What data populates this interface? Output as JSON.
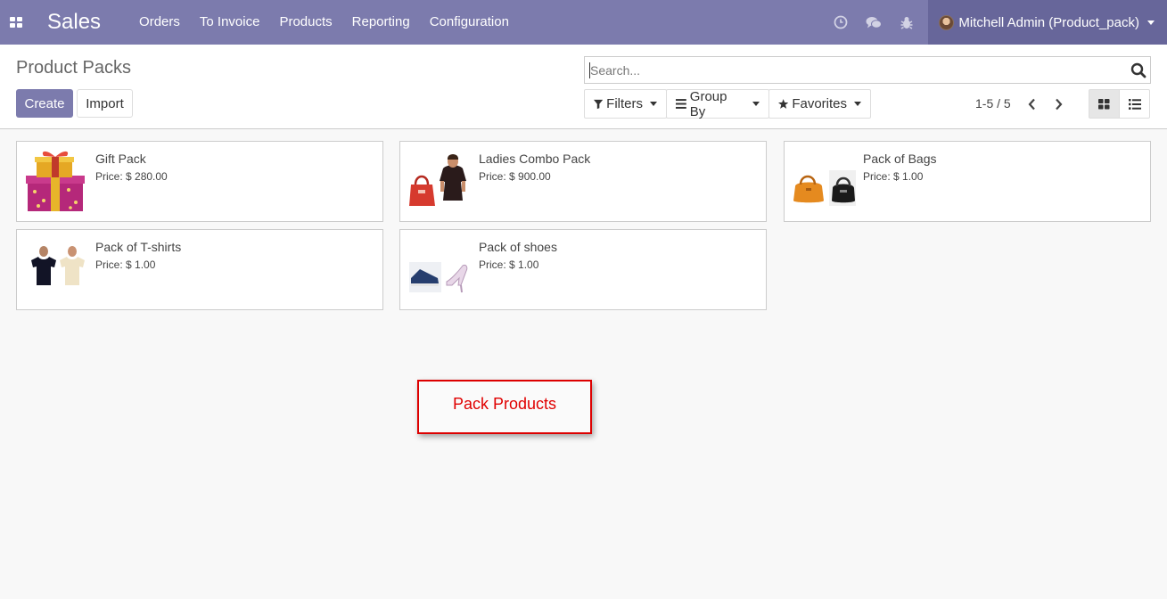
{
  "navbar": {
    "brand": "Sales",
    "menu": [
      "Orders",
      "To Invoice",
      "Products",
      "Reporting",
      "Configuration"
    ],
    "user": "Mitchell Admin (Product_pack)",
    "bg_color": "#7c7bad"
  },
  "control_panel": {
    "title": "Product Packs",
    "create_label": "Create",
    "import_label": "Import",
    "search_placeholder": "Search...",
    "filters_label": "Filters",
    "groupby_label": "Group By",
    "favorites_label": "Favorites",
    "pager": "1-5 / 5"
  },
  "cards": [
    {
      "name": "Gift Pack",
      "price": "Price: $ 280.00",
      "image": "gift-box-icon"
    },
    {
      "name": "Ladies Combo Pack",
      "price": "Price: $ 900.00",
      "image": "handbag-and-top-icon"
    },
    {
      "name": "Pack of Bags",
      "price": "Price: $ 1.00",
      "image": "bags-icon"
    },
    {
      "name": "Pack of T-shirts",
      "price": "Price: $ 1.00",
      "image": "tshirts-icon"
    },
    {
      "name": "Pack of shoes",
      "price": "Price: $ 1.00",
      "image": "shoes-icon"
    }
  ],
  "annotation": {
    "text": "Pack Products",
    "color": "#e00000"
  }
}
